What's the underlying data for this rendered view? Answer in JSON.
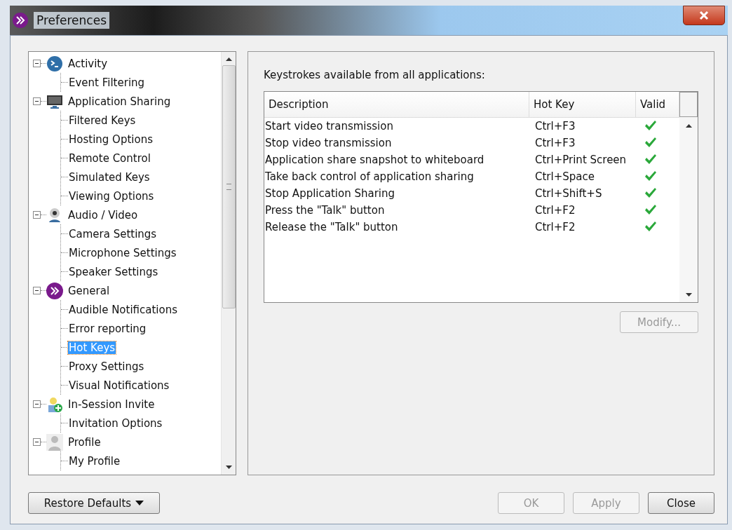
{
  "window": {
    "title": "Preferences"
  },
  "tree": [
    {
      "label": "Activity",
      "kind": "terminal",
      "expanded": true,
      "children": [
        {
          "label": "Event Filtering",
          "selected": false
        }
      ]
    },
    {
      "label": "Application Sharing",
      "kind": "monitor",
      "expanded": true,
      "children": [
        {
          "label": "Filtered Keys",
          "selected": false
        },
        {
          "label": "Hosting Options",
          "selected": false
        },
        {
          "label": "Remote Control",
          "selected": false
        },
        {
          "label": "Simulated Keys",
          "selected": false
        },
        {
          "label": "Viewing Options",
          "selected": false
        }
      ]
    },
    {
      "label": "Audio / Video",
      "kind": "webcam",
      "expanded": true,
      "children": [
        {
          "label": "Camera Settings",
          "selected": false
        },
        {
          "label": "Microphone Settings",
          "selected": false
        },
        {
          "label": "Speaker Settings",
          "selected": false
        }
      ]
    },
    {
      "label": "General",
      "kind": "brand",
      "expanded": true,
      "children": [
        {
          "label": "Audible Notifications",
          "selected": false
        },
        {
          "label": "Error reporting",
          "selected": false
        },
        {
          "label": "Hot Keys",
          "selected": true
        },
        {
          "label": "Proxy Settings",
          "selected": false
        },
        {
          "label": "Visual Notifications",
          "selected": false
        }
      ]
    },
    {
      "label": "In-Session Invite",
      "kind": "invite",
      "expanded": true,
      "children": [
        {
          "label": "Invitation Options",
          "selected": false
        }
      ]
    },
    {
      "label": "Profile",
      "kind": "person",
      "expanded": true,
      "children": [
        {
          "label": "My Profile",
          "selected": false
        }
      ]
    }
  ],
  "panel": {
    "heading": "Keystrokes available from all applications:",
    "columns": [
      "Description",
      "Hot Key",
      "Valid"
    ],
    "rows": [
      {
        "description": "Start video transmission",
        "hot_key": "Ctrl+F3",
        "valid": true
      },
      {
        "description": "Stop video transmission",
        "hot_key": "Ctrl+F3",
        "valid": true
      },
      {
        "description": "Application share snapshot to whiteboard",
        "hot_key": "Ctrl+Print Screen",
        "valid": true
      },
      {
        "description": "Take back control of application sharing",
        "hot_key": "Ctrl+Space",
        "valid": true
      },
      {
        "description": "Stop Application Sharing",
        "hot_key": "Ctrl+Shift+S",
        "valid": true
      },
      {
        "description": "Press the \"Talk\" button",
        "hot_key": "Ctrl+F2",
        "valid": true
      },
      {
        "description": "Release the \"Talk\" button",
        "hot_key": "Ctrl+F2",
        "valid": true
      }
    ],
    "modify_button": {
      "label": "Modify...",
      "disabled": true
    }
  },
  "restore_button": {
    "label": "Restore Defaults"
  },
  "buttons": [
    {
      "label": "OK",
      "disabled": true
    },
    {
      "label": "Apply",
      "disabled": true
    },
    {
      "label": "Close",
      "disabled": false
    }
  ]
}
